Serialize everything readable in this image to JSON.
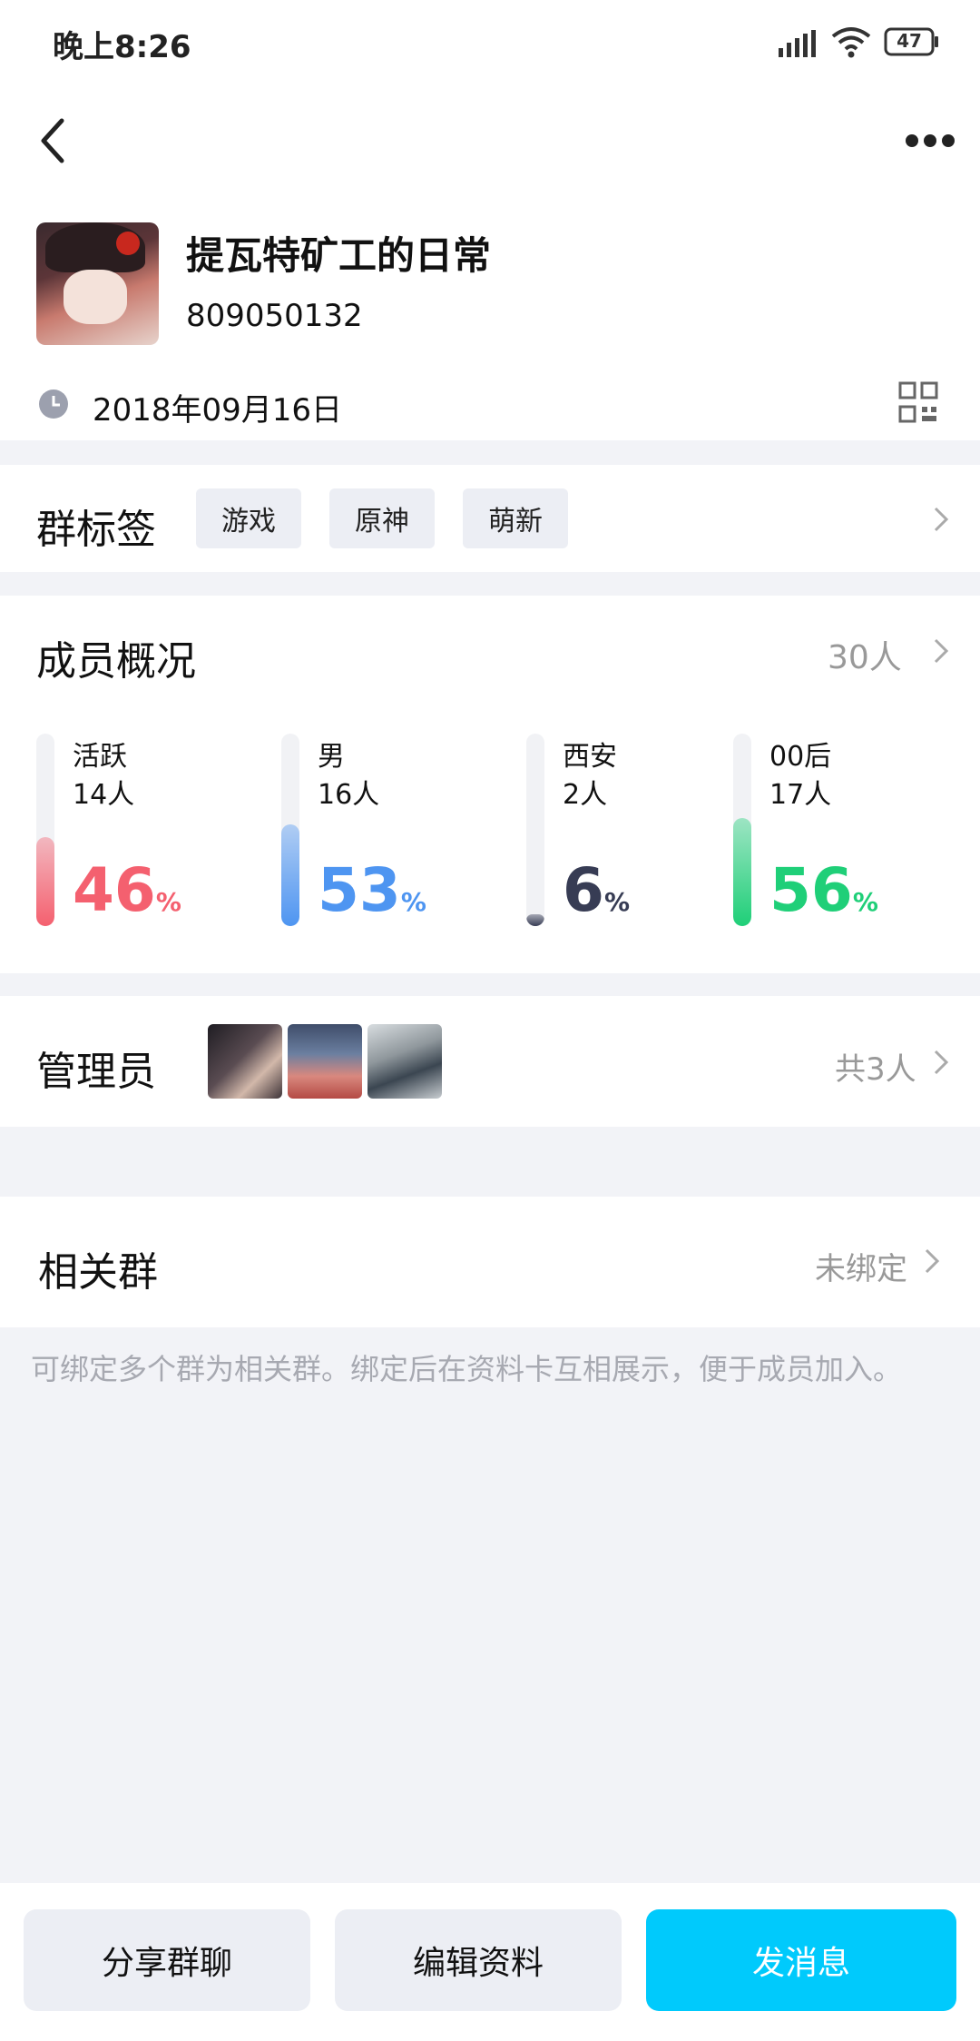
{
  "status_bar": {
    "time": "晚上8:26",
    "battery": "47"
  },
  "group": {
    "name": "提瓦特矿工的日常",
    "id": "809050132",
    "created_date": "2018年09月16日"
  },
  "tags": {
    "title": "群标签",
    "items": [
      "游戏",
      "原神",
      "萌新"
    ]
  },
  "members": {
    "title": "成员概况",
    "count": "30人",
    "stats": [
      {
        "label": "活跃",
        "count": "14人",
        "percent": 46,
        "color": "#f4606f"
      },
      {
        "label": "男",
        "count": "16人",
        "percent": 53,
        "color": "#4e95f1"
      },
      {
        "label": "西安",
        "count": "2人",
        "percent": 6,
        "color": "#373c54"
      },
      {
        "label": "00后",
        "count": "17人",
        "percent": 56,
        "color": "#1fcf78"
      }
    ],
    "percent_unit": "%"
  },
  "admins": {
    "title": "管理员",
    "total": "共3人"
  },
  "related": {
    "title": "相关群",
    "status": "未绑定",
    "description": "可绑定多个群为相关群。绑定后在资料卡互相展示，便于成员加入。"
  },
  "actions": {
    "share": "分享群聊",
    "edit": "编辑资料",
    "message": "发消息"
  },
  "colors": {
    "primary": "#00cafc",
    "muted": "#999999",
    "background": "#f2f3f7"
  }
}
